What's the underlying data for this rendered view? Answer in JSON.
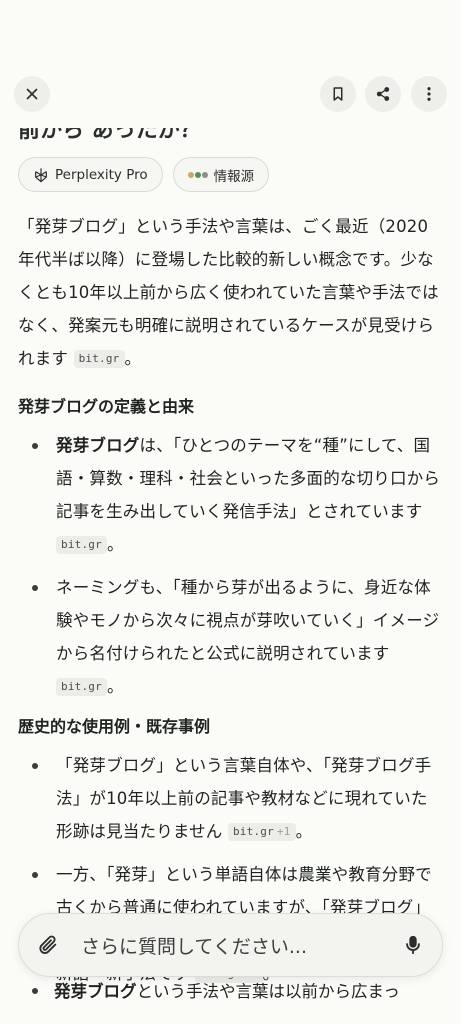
{
  "header": {
    "partial_title": "前から あったか？"
  },
  "chips": {
    "pro_label": "Perplexity Pro",
    "sources_label": "情報源"
  },
  "intro": {
    "text": "「発芽ブログ」という手法や言葉は、ごく最近（2020年代半ば以降）に登場した比較的新しい概念です。少なくとも10年以上前から広く使われていた言葉や手法ではなく、発案元も明確に説明されているケースが見受けられます",
    "cite": "bit.gr",
    "end": "。"
  },
  "section1": {
    "heading": "発芽ブログの定義と由来",
    "items": [
      {
        "bold": "発芽ブログ",
        "text": "は、「ひとつのテーマを“種”にして、国語・算数・理科・社会といった多面的な切り口から記事を生み出していく発信手法」とされています",
        "cite": "bit.gr",
        "end": "。"
      },
      {
        "bold": "",
        "text": "ネーミングも、「種から芽が出るように、身近な体験やモノから次々に視点が芽吹いていく」イメージから名付けられたと公式に説明されています",
        "cite": "bit.gr",
        "end": "。"
      }
    ]
  },
  "section2": {
    "heading": "歴史的な使用例・既存事例",
    "items": [
      {
        "text": "「発芽ブログ」という言葉自体や、「発芽ブログ手法」が10年以上前の記事や教材などに現れていた形跡は見当たりません",
        "cite": "bit.gr",
        "cite_more": "+1",
        "end": "。"
      },
      {
        "text": "一方、「発芽」という単語自体は農業や教育分野で古くから普通に使われていますが、「発芽ブログ」はその比喩表現を現代のブログ手法に落とし込んだ新語・新手法です",
        "cite": "bit.gr",
        "cite_more": "+1",
        "end": "。"
      }
    ]
  },
  "bottom": {
    "bold": "発芽ブログ",
    "text": "という手法や言葉は以前から広まっ"
  },
  "composer": {
    "placeholder": "さらに質問してください..."
  },
  "colors": {
    "background": "#fbfbf8",
    "button_bg": "#eeeeea",
    "text": "#1f2421"
  },
  "icons": [
    "close-icon",
    "bookmark-icon",
    "share-icon",
    "more-vertical-icon",
    "perplexity-logo-icon",
    "paperclip-icon",
    "microphone-icon"
  ]
}
